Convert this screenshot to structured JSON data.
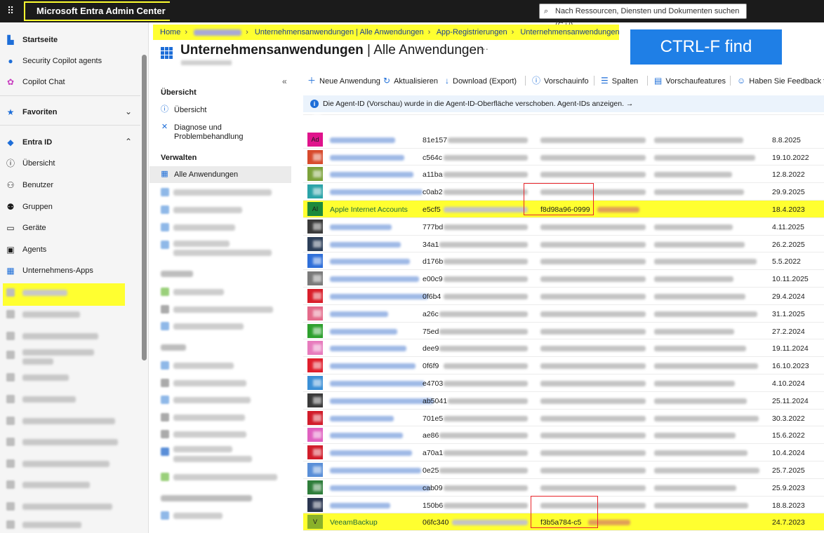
{
  "topbar": {
    "brand": "Microsoft Entra Admin Center",
    "search_placeholder": "Nach Ressourcen, Diensten und Dokumenten suchen (G+/)"
  },
  "leftnav": {
    "home": "Startseite",
    "security_copilot": "Security Copilot agents",
    "copilot_chat": "Copilot Chat",
    "favorites": "Favoriten",
    "entra_id": "Entra ID",
    "overview": "Übersicht",
    "users": "Benutzer",
    "groups": "Gruppen",
    "devices": "Geräte",
    "agents": "Agents",
    "enterprise_apps": "Unternehmens-Apps"
  },
  "breadcrumb": {
    "home": "Home",
    "enterprise_all": "Unternehmensanwendungen | Alle Anwendungen",
    "app_reg": "App-Registrierungen",
    "enterprise": "Unternehmensanwendungen"
  },
  "page": {
    "title_main": "Unternehmensanwendungen",
    "title_sub": " | Alle Anwendungen",
    "more": "···"
  },
  "callout": "CTRL-F find",
  "innernav": {
    "collapse": "«",
    "overview_head": "Übersicht",
    "overview": "Übersicht",
    "diagnose_line1": "Diagnose und",
    "diagnose_line2": "Problembehandlung",
    "manage_head": "Verwalten",
    "all_apps": "Alle Anwendungen"
  },
  "toolbar": {
    "new_app": "Neue Anwendung",
    "refresh": "Aktualisieren",
    "download": "Download (Export)",
    "preview_info": "Vorschauinfo",
    "columns": "Spalten",
    "preview_features": "Vorschaufeatures",
    "feedback": "Haben Sie Feedback fü"
  },
  "banner": "Die Agent-ID (Vorschau) wurde in die Agent-ID-Oberfläche verschoben. Agent-IDs anzeigen.  →",
  "rows": [
    {
      "name": "",
      "id": "",
      "obj": "",
      "date": "",
      "color": "#3a7bd5"
    },
    {
      "name": "",
      "id": "81e157",
      "obj": "",
      "date": "8.8.2025",
      "color": "#e0138c",
      "logo": "Ad"
    },
    {
      "name": "",
      "id": "c564c",
      "obj": "",
      "date": "19.10.2022",
      "color": "#d74a2c"
    },
    {
      "name": "",
      "id": "a11ba",
      "obj": "",
      "date": "12.8.2022",
      "color": "#7ba23a"
    },
    {
      "name": "",
      "id": "c0ab2",
      "obj": "",
      "date": "29.9.2025",
      "color": "#2aa3a8"
    },
    {
      "name": "Apple Internet Accounts",
      "id": "e5cf5",
      "obj": "f8d98a96-0999",
      "date": "18.4.2023",
      "color": "#1c8a3c",
      "logo": "AI",
      "highlight": true
    },
    {
      "name": "",
      "id": "777bd",
      "obj": "",
      "date": "4.11.2025",
      "color": "#3a3a3a"
    },
    {
      "name": "",
      "id": "34a1",
      "obj": "",
      "date": "26.2.2025",
      "color": "#2c3e58"
    },
    {
      "name": "",
      "id": "d176b",
      "obj": "",
      "date": "5.5.2022",
      "color": "#2f6fd9"
    },
    {
      "name": "",
      "id": "e00c9",
      "obj": "",
      "date": "10.11.2025",
      "color": "#7a7a7a"
    },
    {
      "name": "",
      "id": "0f6b4",
      "obj": "",
      "date": "29.4.2024",
      "color": "#d91e2a"
    },
    {
      "name": "",
      "id": "a26c",
      "obj": "",
      "date": "31.1.2025",
      "color": "#e46a8a"
    },
    {
      "name": "",
      "id": "75ed",
      "obj": "",
      "date": "27.2.2024",
      "color": "#2ea02e"
    },
    {
      "name": "",
      "id": "dee9",
      "obj": "",
      "date": "19.11.2024",
      "color": "#e77bbd"
    },
    {
      "name": "",
      "id": "0f6f9",
      "obj": "",
      "date": "16.10.2023",
      "color": "#e01e2c"
    },
    {
      "name": "",
      "id": "e4703",
      "obj": "",
      "date": "4.10.2024",
      "color": "#3b8fd6"
    },
    {
      "name": "",
      "id": "ab5041",
      "obj": "",
      "date": "25.11.2024",
      "color": "#3a3a3a"
    },
    {
      "name": "",
      "id": "701e5",
      "obj": "",
      "date": "30.3.2022",
      "color": "#d11c2a"
    },
    {
      "name": "",
      "id": "ae86",
      "obj": "",
      "date": "15.6.2022",
      "color": "#e060c0"
    },
    {
      "name": "",
      "id": "a70a1",
      "obj": "",
      "date": "10.4.2024",
      "color": "#d11c2a"
    },
    {
      "name": "",
      "id": "0e25",
      "obj": "",
      "date": "25.7.2025",
      "color": "#5a8fd8"
    },
    {
      "name": "",
      "id": "cab09",
      "obj": "",
      "date": "25.9.2023",
      "color": "#2e7d3a"
    },
    {
      "name": "",
      "id": "150b6",
      "obj": "",
      "date": "18.8.2023",
      "color": "#2a3550"
    },
    {
      "name": "VeeamBackup",
      "id": "06fc340",
      "obj": "f3b5a784-c5",
      "date": "24.7.2023",
      "color": "#8ab12a",
      "logo": "V",
      "highlight": true
    }
  ]
}
